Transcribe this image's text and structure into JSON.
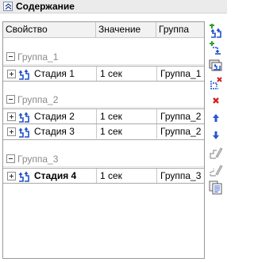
{
  "panel": {
    "title": "Содержание"
  },
  "columns": {
    "property": "Свойство",
    "value": "Значение",
    "group": "Группа"
  },
  "groups": [
    {
      "label": "Группа_1"
    },
    {
      "label": "Группа_2"
    },
    {
      "label": "Группа_3"
    }
  ],
  "rows": [
    {
      "name": "Стадия 1",
      "value": "1 сек",
      "group": "Группа_1"
    },
    {
      "name": "Стадия 2",
      "value": "1 сек",
      "group": "Группа_2"
    },
    {
      "name": "Стадия 3",
      "value": "1 сек",
      "group": "Группа_2"
    },
    {
      "name": "Стадия 4",
      "value": "1 сек",
      "group": "Группа_3"
    }
  ],
  "toolbar": {
    "buttons": [
      {
        "icon": "add-stage-icon"
      },
      {
        "icon": "add-substage-icon"
      },
      {
        "icon": "copy-stage-icon"
      },
      {
        "icon": "delete-group-icon"
      },
      {
        "icon": "delete-icon"
      },
      {
        "icon": "move-up-icon"
      },
      {
        "icon": "move-down-icon"
      },
      {
        "icon": "edit-disabled-icon"
      },
      {
        "icon": "edit-group-disabled-icon"
      },
      {
        "icon": "properties-icon"
      }
    ]
  },
  "colors": {
    "group_text": "#8a8a8a",
    "add_green": "#2e9e2e",
    "delete_red": "#d42020",
    "arrow_blue": "#2b55d6"
  }
}
